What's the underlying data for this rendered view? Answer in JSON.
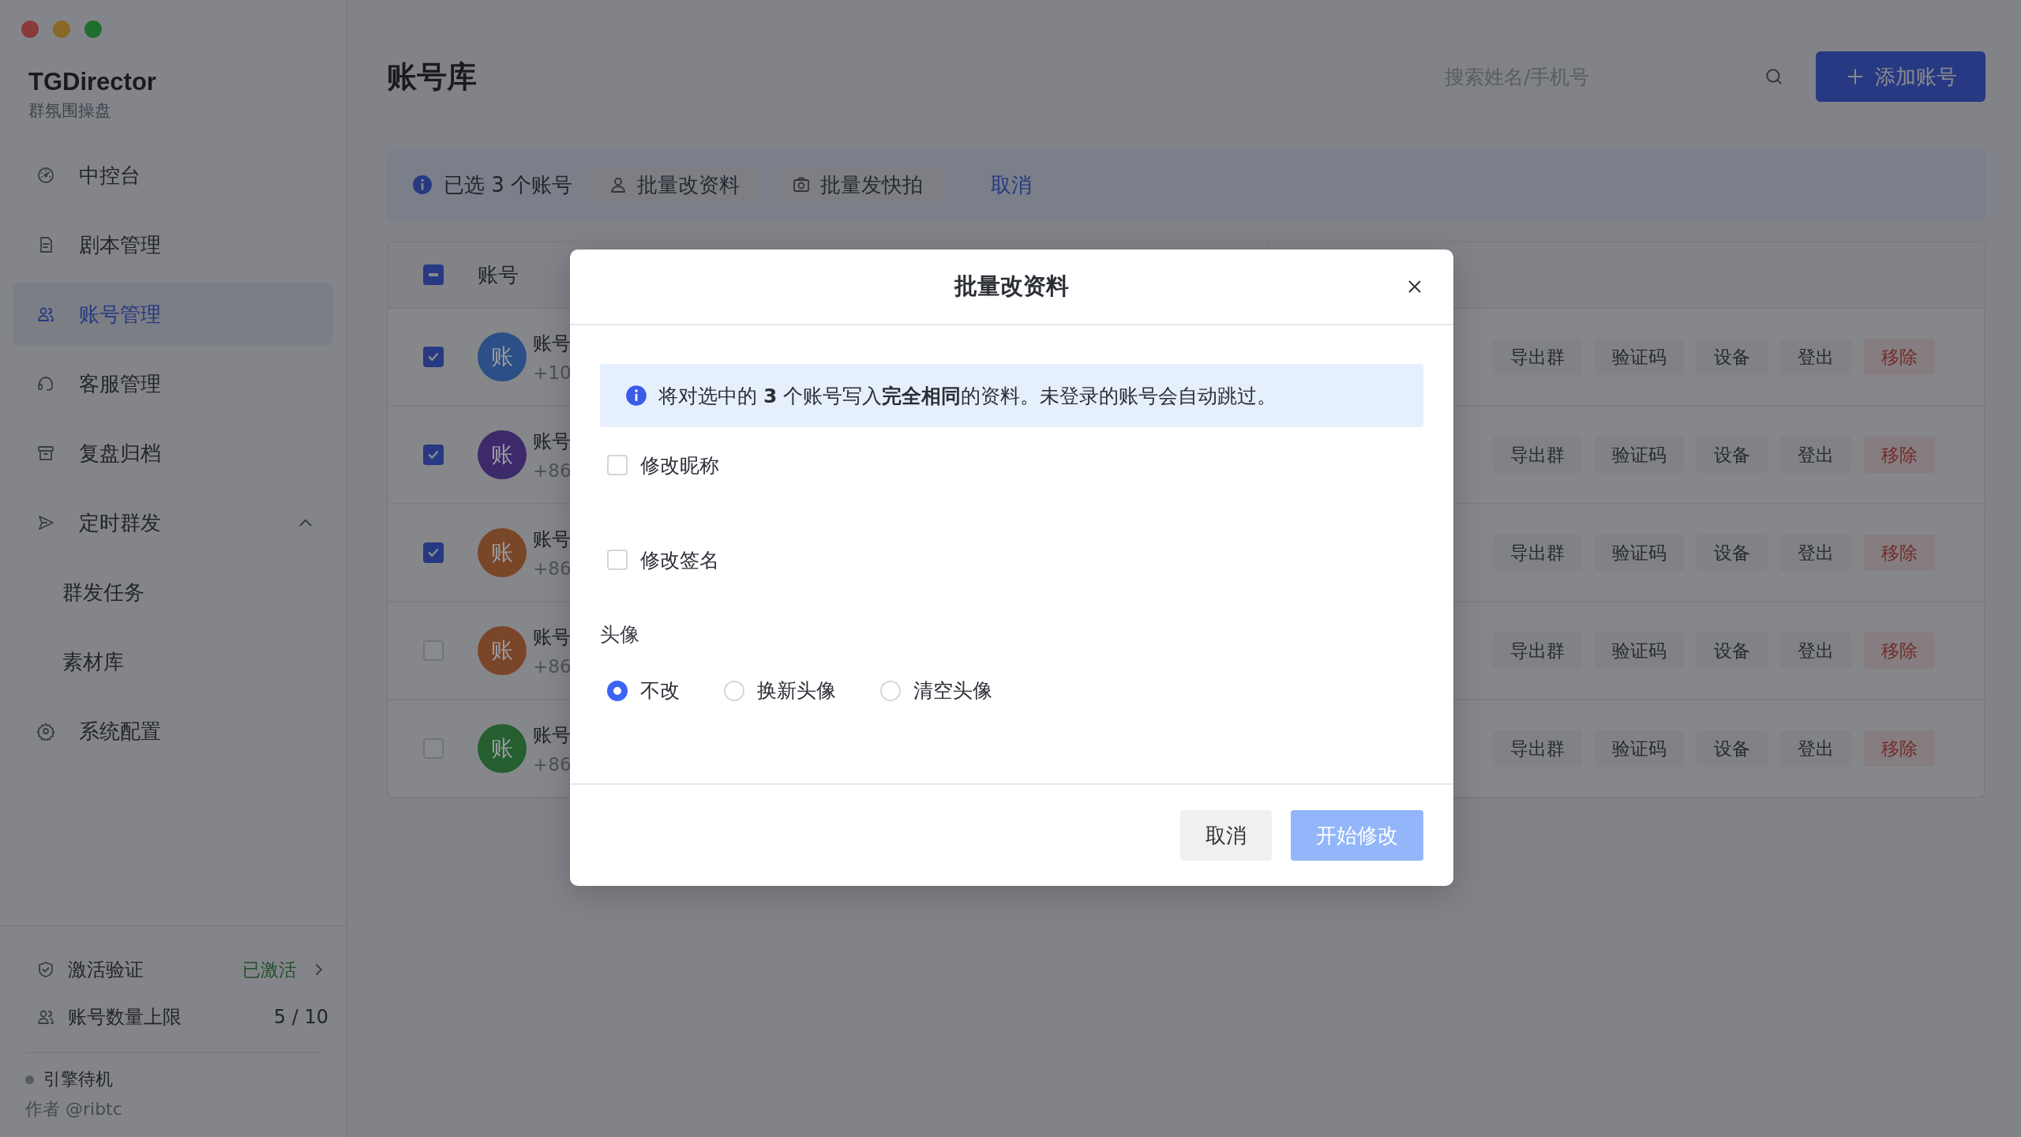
{
  "sidebar": {
    "brand": "TGDirector",
    "subtitle": "群氛围操盘",
    "items": [
      {
        "label": "中控台",
        "selected": false
      },
      {
        "label": "剧本管理",
        "selected": false
      },
      {
        "label": "账号管理",
        "selected": true
      },
      {
        "label": "客服管理",
        "selected": false
      },
      {
        "label": "复盘归档",
        "selected": false
      },
      {
        "label": "定时群发",
        "selected": false,
        "expanded": true,
        "children": [
          {
            "label": "群发任务",
            "selected": false
          },
          {
            "label": "素材库",
            "selected": false
          }
        ]
      },
      {
        "label": "系统配置",
        "selected": false
      }
    ],
    "activation": {
      "label": "激活验证",
      "status": "已激活"
    },
    "quota": {
      "label": "账号数量上限",
      "value": "5 / 10"
    },
    "engine": {
      "status": "引擎待机"
    },
    "author": "作者 @ribtc"
  },
  "page": {
    "title": "账号库",
    "search": {
      "placeholder": "搜索姓名/手机号"
    },
    "add_button": "添加账号",
    "selection_bar": {
      "text": "已选 3 个账号",
      "actions": [
        "批量改资料",
        "批量发快拍"
      ],
      "cancel": "取消"
    },
    "table": {
      "header": {
        "indeterminate": true,
        "column": "账号"
      },
      "rows": [
        {
          "checked": true,
          "avatar": "账",
          "color": "#2b4f86",
          "name": "账号",
          "phone": "+10",
          "actions": [
            {
              "label": "导出群",
              "kind": "normal"
            },
            {
              "label": "验证码",
              "kind": "normal"
            },
            {
              "label": "设备",
              "kind": "normal"
            },
            {
              "label": "登出",
              "kind": "normal"
            },
            {
              "label": "移除",
              "kind": "danger"
            }
          ]
        },
        {
          "checked": true,
          "avatar": "账",
          "color": "#3d2a6a",
          "name": "账号",
          "phone": "+86",
          "actions": [
            {
              "label": "导出群",
              "kind": "normal"
            },
            {
              "label": "验证码",
              "kind": "normal"
            },
            {
              "label": "设备",
              "kind": "normal"
            },
            {
              "label": "登出",
              "kind": "normal"
            },
            {
              "label": "移除",
              "kind": "danger"
            }
          ]
        },
        {
          "checked": true,
          "avatar": "账",
          "color": "#7a4628",
          "name": "账号",
          "phone": "+86",
          "actions": [
            {
              "label": "导出群",
              "kind": "normal"
            },
            {
              "label": "验证码",
              "kind": "normal"
            },
            {
              "label": "设备",
              "kind": "normal"
            },
            {
              "label": "登出",
              "kind": "normal"
            },
            {
              "label": "移除",
              "kind": "danger"
            }
          ]
        },
        {
          "checked": false,
          "avatar": "账",
          "color": "#7a4629",
          "name": "账号",
          "phone": "+86",
          "actions": [
            {
              "label": "导出群",
              "kind": "normal"
            },
            {
              "label": "验证码",
              "kind": "normal"
            },
            {
              "label": "设备",
              "kind": "normal"
            },
            {
              "label": "登出",
              "kind": "normal"
            },
            {
              "label": "移除",
              "kind": "danger"
            }
          ]
        },
        {
          "checked": false,
          "avatar": "账",
          "color": "#255f30",
          "name": "账号",
          "phone": "+86",
          "actions": [
            {
              "label": "导出群",
              "kind": "normal"
            },
            {
              "label": "验证码",
              "kind": "normal"
            },
            {
              "label": "设备",
              "kind": "normal"
            },
            {
              "label": "登出",
              "kind": "normal"
            },
            {
              "label": "移除",
              "kind": "danger"
            }
          ]
        }
      ]
    }
  },
  "dialog": {
    "title": "批量改资料",
    "notice": "将对选中的 **3** 个账号写入**完全相同**的资料。未登录的账号会自动跳过。",
    "options": [
      {
        "label": "修改昵称",
        "checked": false
      },
      {
        "label": "修改签名",
        "checked": false
      }
    ],
    "avatar": {
      "label": "头像",
      "choices": [
        {
          "label": "不改",
          "selected": true
        },
        {
          "label": "换新头像",
          "selected": false
        },
        {
          "label": "清空头像",
          "selected": false
        }
      ]
    },
    "buttons": [
      {
        "label": "取消",
        "kind": "secondary",
        "disabled": false
      },
      {
        "label": "开始修改",
        "kind": "primary",
        "disabled": true
      }
    ]
  }
}
